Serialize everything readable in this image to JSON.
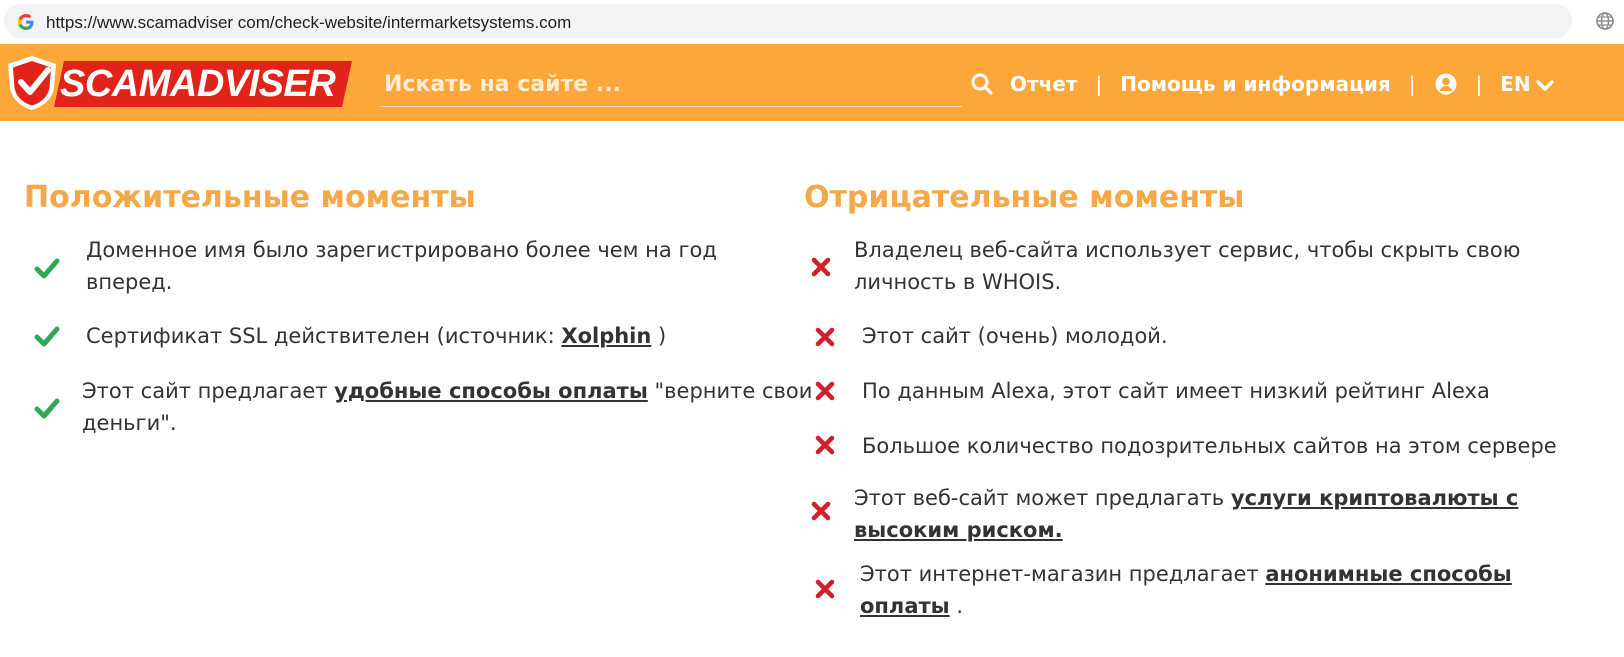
{
  "browser": {
    "url": "https://www.scamadviser com/check-website/intermarketsystems.com",
    "site_icon": "google-g-icon",
    "right_icon": "globe-icon"
  },
  "header": {
    "logo_text": "SCAMADVISER",
    "search_placeholder": "Искать на сайте ...",
    "nav": {
      "report": "Отчет",
      "sep1": "|",
      "help": "Помощь и информация",
      "sep2": "|",
      "sep3": "|",
      "lang": "EN"
    },
    "colors": {
      "header_bg": "#fda63a",
      "logo_red": "#e2231a"
    }
  },
  "positive": {
    "title": "Положительные моменты",
    "items": [
      {
        "line1": "Доменное имя было зарегистрировано более чем на год",
        "line2": "вперед."
      },
      {
        "text_before": "Сертификат SSL действителен (источник: ",
        "link": "Xolphin",
        "text_after": " )"
      },
      {
        "text_before": "Этот сайт предлагает ",
        "link": "удобные способы оплаты",
        "text_after": " \"верните свои",
        "line2": "деньги\"."
      }
    ],
    "icon": "check-icon",
    "color": "#2eaa57"
  },
  "negative": {
    "title": "Отрицательные моменты",
    "items": [
      {
        "line1": "Владелец веб-сайта использует сервис, чтобы скрыть свою",
        "line2": "личность в WHOIS."
      },
      {
        "line1": "Этот сайт (очень) молодой."
      },
      {
        "line1": "По данным Alexa, этот сайт имеет низкий рейтинг Alexa"
      },
      {
        "line1": "Большое количество подозрительных сайтов на этом сервере"
      },
      {
        "text_before": "Этот веб-сайт может предлагать ",
        "link1": "услуги криптовалюты с",
        "link2": "высоким риском."
      },
      {
        "text_before": "Этот интернет-магазин предлагает ",
        "link1": "анонимные способы",
        "link2": "оплаты",
        "text_after": " ."
      }
    ],
    "icon": "cross-icon",
    "color": "#d0202a"
  }
}
